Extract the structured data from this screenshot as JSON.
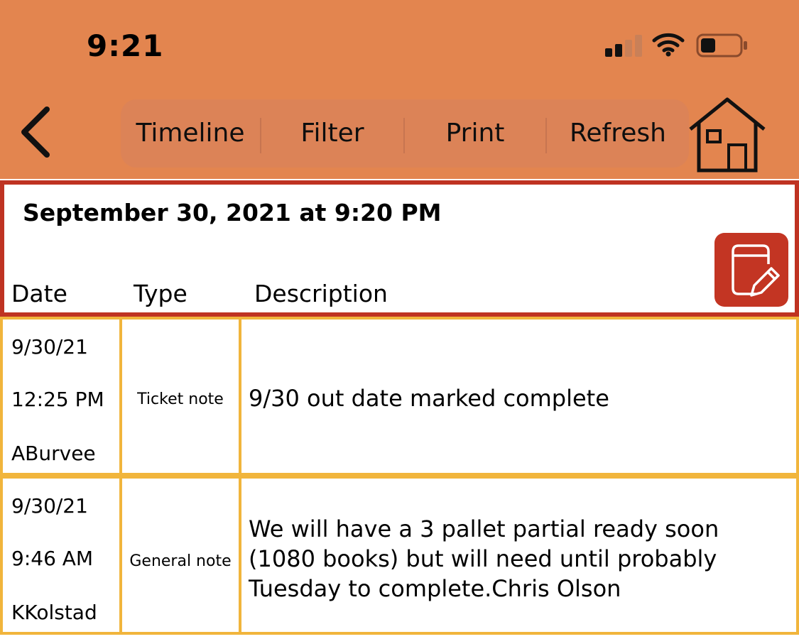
{
  "status_bar": {
    "time": "9:21",
    "signal_icon": "cellular-signal-icon",
    "wifi_icon": "wifi-icon",
    "battery_icon": "battery-icon"
  },
  "nav": {
    "back_icon": "chevron-left-icon",
    "segments": [
      "Timeline",
      "Filter",
      "Print",
      "Refresh"
    ],
    "home_icon": "house-icon"
  },
  "header": {
    "timestamp": "September 30, 2021 at 9:20 PM",
    "columns": {
      "date": "Date",
      "type": "Type",
      "description": "Description"
    },
    "edit_icon": "note-edit-icon"
  },
  "rows": [
    {
      "date": "9/30/21",
      "time": "12:25 PM",
      "user": "ABurvee",
      "type": "Ticket note",
      "description": "9/30 out date marked complete"
    },
    {
      "date": "9/30/21",
      "time": "9:46 AM",
      "user": "KKolstad",
      "type": "General note",
      "description_lines": [
        "We will have a 3 pallet partial ready soon",
        "(1080 books) but will need until probably",
        "Tuesday to complete.Chris Olson"
      ]
    }
  ],
  "colors": {
    "top_bar": "#e3854f",
    "segment_bg": "#dc8357",
    "header_border": "#bf3322",
    "edit_button": "#c33523",
    "row_border": "#f1b53c"
  }
}
